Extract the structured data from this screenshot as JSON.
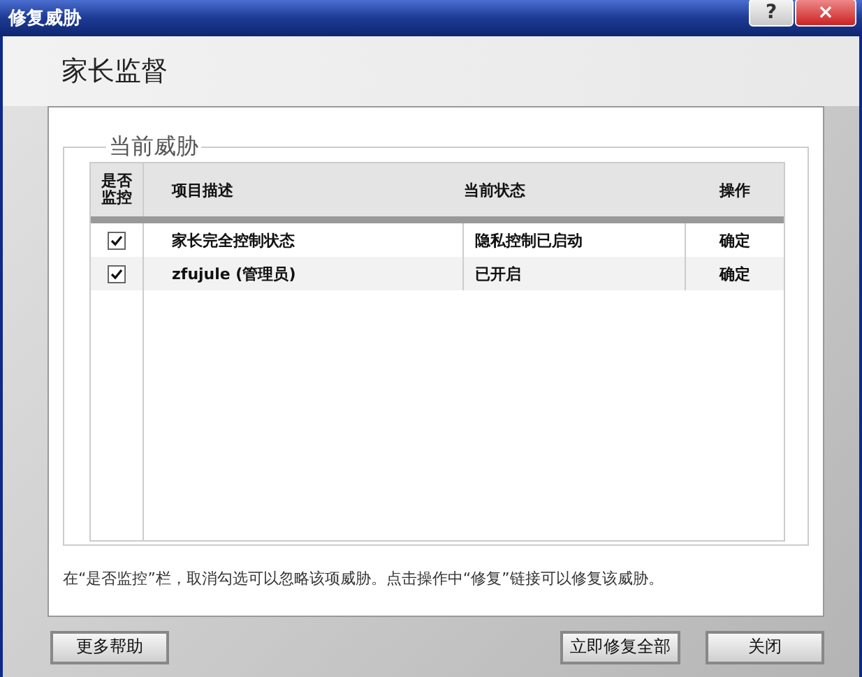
{
  "window": {
    "title": "修复威胁",
    "help_button": "?",
    "close_button": "×"
  },
  "header": {
    "title": "家长监督"
  },
  "group": {
    "legend": "当前威胁"
  },
  "table": {
    "columns": [
      "是否监控",
      "项目描述",
      "当前状态",
      "操作"
    ],
    "rows": [
      {
        "checked": true,
        "description": "家长完全控制状态",
        "status": "隐私控制已启动",
        "action": "确定"
      },
      {
        "checked": true,
        "description": "zfujule (管理员)",
        "status": "已开启",
        "action": "确定"
      }
    ]
  },
  "hint": "在“是否监控”栏，取消勾选可以忽略该项威胁。点击操作中“修复”链接可以修复该威胁。",
  "buttons": [
    {
      "label": "更多帮助"
    },
    {
      "label": "立即修复全部"
    },
    {
      "label": "关闭"
    }
  ]
}
